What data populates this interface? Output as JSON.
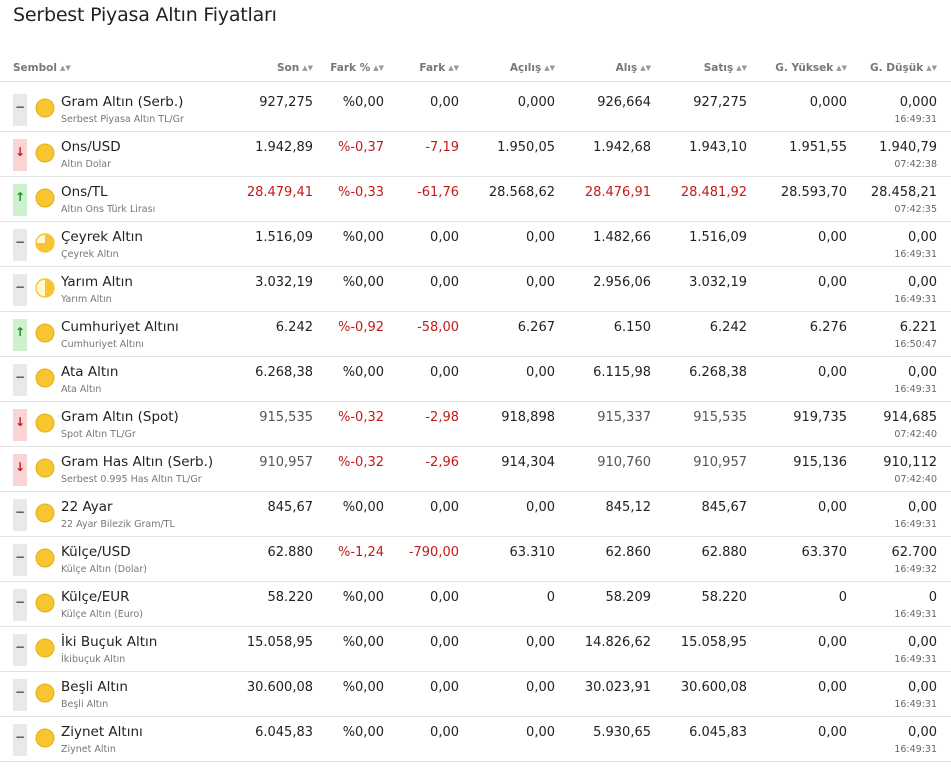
{
  "title": "Serbest Piyasa Altın Fiyatları",
  "columns": [
    "Sembol",
    "Son",
    "Fark %",
    "Fark",
    "Açılış",
    "Alış",
    "Satış",
    "G. Yüksek",
    "G. Düşük"
  ],
  "colors": {
    "red": "#c41a1a",
    "green": "#1d8a1d",
    "coin": "#f7c530"
  },
  "rows": [
    {
      "direction": "flat",
      "icon": "gold-coin-full-icon",
      "name": "Gram Altın (Serb.)",
      "sub": "Serbest Piyasa Altın TL/Gr",
      "son": "927,275",
      "fark_pct": "%0,00",
      "fark": "0,00",
      "acilis": "0,000",
      "alis": "926,664",
      "satis": "927,275",
      "yuksek": "0,000",
      "dusuk": "0,000",
      "time": "16:49:31",
      "red_cols": []
    },
    {
      "direction": "down",
      "icon": "gold-coin-full-icon",
      "name": "Ons/USD",
      "sub": "Altın Dolar",
      "son": "1.942,89",
      "fark_pct": "%-0,37",
      "fark": "-7,19",
      "acilis": "1.950,05",
      "alis": "1.942,68",
      "satis": "1.943,10",
      "yuksek": "1.951,55",
      "dusuk": "1.940,79",
      "time": "07:42:38",
      "red_cols": [
        "fark_pct",
        "fark"
      ]
    },
    {
      "direction": "up",
      "icon": "gold-coin-full-icon",
      "name": "Ons/TL",
      "sub": "Altın Ons Türk Lirası",
      "son": "28.479,41",
      "fark_pct": "%-0,33",
      "fark": "-61,76",
      "acilis": "28.568,62",
      "alis": "28.476,91",
      "satis": "28.481,92",
      "yuksek": "28.593,70",
      "dusuk": "28.458,21",
      "time": "07:42:35",
      "red_cols": [
        "son",
        "fark_pct",
        "fark",
        "alis",
        "satis"
      ]
    },
    {
      "direction": "flat",
      "icon": "gold-coin-quarter-icon",
      "name": "Çeyrek Altın",
      "sub": "Çeyrek Altın",
      "son": "1.516,09",
      "fark_pct": "%0,00",
      "fark": "0,00",
      "acilis": "0,00",
      "alis": "1.482,66",
      "satis": "1.516,09",
      "yuksek": "0,00",
      "dusuk": "0,00",
      "time": "16:49:31",
      "red_cols": []
    },
    {
      "direction": "flat",
      "icon": "gold-coin-half-icon",
      "name": "Yarım Altın",
      "sub": "Yarım Altın",
      "son": "3.032,19",
      "fark_pct": "%0,00",
      "fark": "0,00",
      "acilis": "0,00",
      "alis": "2.956,06",
      "satis": "3.032,19",
      "yuksek": "0,00",
      "dusuk": "0,00",
      "time": "16:49:31",
      "red_cols": []
    },
    {
      "direction": "up",
      "icon": "gold-coin-full-icon",
      "name": "Cumhuriyet Altını",
      "sub": "Cumhuriyet Altını",
      "son": "6.242",
      "fark_pct": "%-0,92",
      "fark": "-58,00",
      "acilis": "6.267",
      "alis": "6.150",
      "satis": "6.242",
      "yuksek": "6.276",
      "dusuk": "6.221",
      "time": "16:50:47",
      "red_cols": [
        "fark_pct",
        "fark"
      ]
    },
    {
      "direction": "flat",
      "icon": "gold-coin-full-icon",
      "name": "Ata Altın",
      "sub": "Ata Altın",
      "son": "6.268,38",
      "fark_pct": "%0,00",
      "fark": "0,00",
      "acilis": "0,00",
      "alis": "6.115,98",
      "satis": "6.268,38",
      "yuksek": "0,00",
      "dusuk": "0,00",
      "time": "16:49:31",
      "red_cols": []
    },
    {
      "direction": "down",
      "icon": "gold-coin-full-icon",
      "name": "Gram Altın (Spot)",
      "sub": "Spot Altın TL/Gr",
      "son": "915,535",
      "fark_pct": "%-0,32",
      "fark": "-2,98",
      "acilis": "918,898",
      "alis": "915,337",
      "satis": "915,535",
      "yuksek": "919,735",
      "dusuk": "914,685",
      "time": "07:42:40",
      "red_cols": [
        "fark_pct",
        "fark"
      ],
      "muted_cols": [
        "son",
        "alis",
        "satis"
      ]
    },
    {
      "direction": "down",
      "icon": "gold-coin-full-icon",
      "name": "Gram Has Altın (Serb.)",
      "sub": "Serbest 0.995 Has Altın TL/Gr",
      "son": "910,957",
      "fark_pct": "%-0,32",
      "fark": "-2,96",
      "acilis": "914,304",
      "alis": "910,760",
      "satis": "910,957",
      "yuksek": "915,136",
      "dusuk": "910,112",
      "time": "07:42:40",
      "red_cols": [
        "fark_pct",
        "fark"
      ],
      "muted_cols": [
        "son",
        "alis",
        "satis"
      ]
    },
    {
      "direction": "flat",
      "icon": "gold-coin-full-icon",
      "name": "22 Ayar",
      "sub": "22 Ayar Bilezik Gram/TL",
      "son": "845,67",
      "fark_pct": "%0,00",
      "fark": "0,00",
      "acilis": "0,00",
      "alis": "845,12",
      "satis": "845,67",
      "yuksek": "0,00",
      "dusuk": "0,00",
      "time": "16:49:31",
      "red_cols": []
    },
    {
      "direction": "flat",
      "icon": "gold-coin-full-icon",
      "name": "Külçe/USD",
      "sub": "Külçe Altın (Dolar)",
      "son": "62.880",
      "fark_pct": "%-1,24",
      "fark": "-790,00",
      "acilis": "63.310",
      "alis": "62.860",
      "satis": "62.880",
      "yuksek": "63.370",
      "dusuk": "62.700",
      "time": "16:49:32",
      "red_cols": [
        "fark_pct",
        "fark"
      ]
    },
    {
      "direction": "flat",
      "icon": "gold-coin-full-icon",
      "name": "Külçe/EUR",
      "sub": "Külçe Altın (Euro)",
      "son": "58.220",
      "fark_pct": "%0,00",
      "fark": "0,00",
      "acilis": "0",
      "alis": "58.209",
      "satis": "58.220",
      "yuksek": "0",
      "dusuk": "0",
      "time": "16:49:31",
      "red_cols": []
    },
    {
      "direction": "flat",
      "icon": "gold-coin-full-icon",
      "name": "İki Buçuk Altın",
      "sub": "İkibuçuk Altın",
      "son": "15.058,95",
      "fark_pct": "%0,00",
      "fark": "0,00",
      "acilis": "0,00",
      "alis": "14.826,62",
      "satis": "15.058,95",
      "yuksek": "0,00",
      "dusuk": "0,00",
      "time": "16:49:31",
      "red_cols": []
    },
    {
      "direction": "flat",
      "icon": "gold-coin-full-icon",
      "name": "Beşli Altın",
      "sub": "Beşli Altın",
      "son": "30.600,08",
      "fark_pct": "%0,00",
      "fark": "0,00",
      "acilis": "0,00",
      "alis": "30.023,91",
      "satis": "30.600,08",
      "yuksek": "0,00",
      "dusuk": "0,00",
      "time": "16:49:31",
      "red_cols": []
    },
    {
      "direction": "flat",
      "icon": "gold-coin-full-icon",
      "name": "Ziynet Altını",
      "sub": "Ziynet Altın",
      "son": "6.045,83",
      "fark_pct": "%0,00",
      "fark": "0,00",
      "acilis": "0,00",
      "alis": "5.930,65",
      "satis": "6.045,83",
      "yuksek": "0,00",
      "dusuk": "0,00",
      "time": "16:49:31",
      "red_cols": []
    }
  ]
}
